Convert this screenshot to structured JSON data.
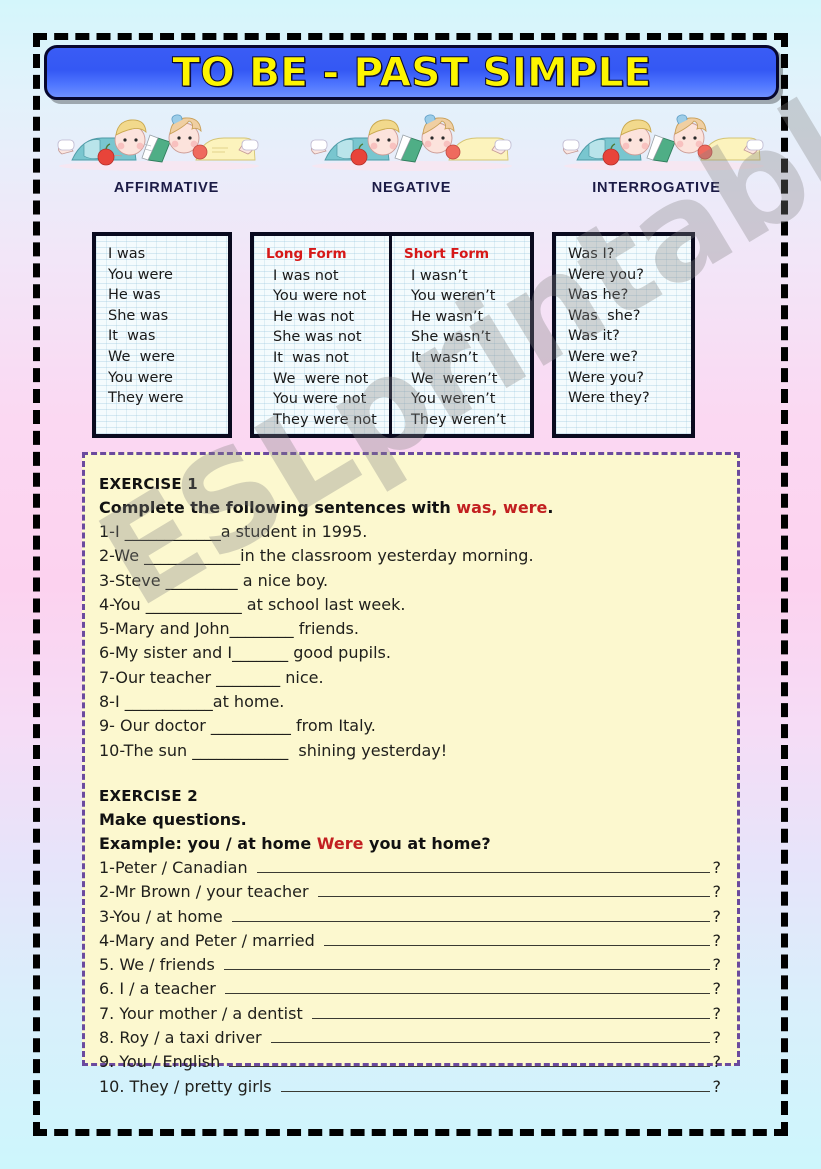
{
  "title": "TO BE - PAST SIMPLE",
  "categories": [
    {
      "label": "AFFIRMATIVE"
    },
    {
      "label": "NEGATIVE"
    },
    {
      "label": "INTERROGATIVE"
    }
  ],
  "tables": {
    "affirmative": {
      "rows": [
        "I was",
        "You were",
        "He was",
        "She was",
        "It  was",
        "We  were",
        "You were",
        "They were"
      ]
    },
    "negative": {
      "long_form_header": "Long Form",
      "long_form_rows": [
        "I was not",
        "You were not",
        "He was not",
        "She was not",
        "It  was not",
        "We  were not",
        "You were not",
        "They were not"
      ],
      "short_form_header": "Short Form",
      "short_form_rows": [
        "I wasn’t",
        "You weren’t",
        "He wasn’t",
        "She wasn’t",
        "It  wasn’t",
        "We  weren’t",
        "You weren’t",
        "They weren’t"
      ]
    },
    "interrogative": {
      "rows": [
        "Was I?",
        "Were you?",
        "Was he?",
        "Was  she?",
        "Was it?",
        "Were we?",
        "Were you?",
        "Were they?"
      ]
    }
  },
  "exercise1": {
    "heading": "EXERCISE 1",
    "instruction_before": "Complete the following sentences with ",
    "instruction_highlight": "was, were",
    "instruction_after": ".",
    "items": [
      "1-I ____________a student in 1995.",
      "2-We ____________in the classroom yesterday morning.",
      "3-Steve _________ a nice boy.",
      "4-You ____________ at school last week.",
      "5-Mary and John________ friends.",
      "6-My sister and I_______ good pupils.",
      "7-Our teacher ________ nice.",
      "8-I ___________at home.",
      "9- Our doctor __________ from Italy.",
      "10-The sun ____________  shining yesterday!"
    ]
  },
  "exercise2": {
    "heading": "EXERCISE 2",
    "instruction": "Make questions.",
    "example_label": "Example:  you / at home   ",
    "example_highlight": "Were",
    "example_rest": " you at home?",
    "items": [
      {
        "label": "1-Peter / Canadian ",
        "mark": "?"
      },
      {
        "label": "2-Mr Brown / your teacher ",
        "mark": "?"
      },
      {
        "label": "3-You / at home ",
        "mark": "?"
      },
      {
        "label": "4-Mary and Peter / married ",
        "mark": "?"
      },
      {
        "label": "5. We / friends ",
        "mark": "?"
      },
      {
        "label": "6. I / a teacher ",
        "mark": "?"
      },
      {
        "label": "7. Your mother / a dentist ",
        "mark": "?"
      },
      {
        "label": "8. Roy / a taxi driver ",
        "mark": "?"
      },
      {
        "label": "9. You / English ",
        "mark": "?"
      },
      {
        "label": "10. They / pretty girls ",
        "mark": "?"
      }
    ]
  },
  "watermark": "ESLprintables.com",
  "colors": {
    "title_text": "#fdf500",
    "banner_blue": "#3a5cf5",
    "highlight_red": "#c22020",
    "form_header_red": "#d61818",
    "panel_bg": "#fcf8cf",
    "panel_border": "#6b4a9e"
  }
}
